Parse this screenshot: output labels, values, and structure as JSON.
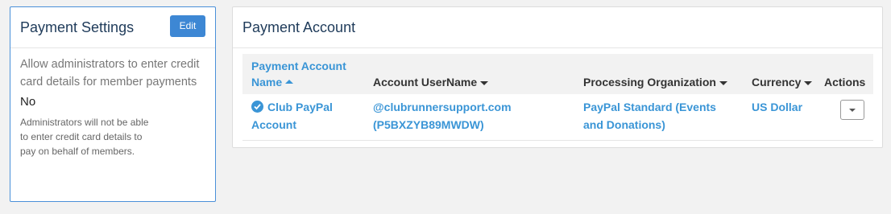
{
  "payment_settings": {
    "title": "Payment Settings",
    "edit_label": "Edit",
    "description": "Allow administrators to enter credit card details for member payments",
    "value": "No",
    "note": "Administrators will not be able to enter credit card details to pay on behalf of members."
  },
  "payment_account": {
    "title": "Payment Account",
    "columns": {
      "name": "Payment Account Name",
      "username": "Account UserName",
      "processing_org": "Processing Organization",
      "currency": "Currency",
      "actions": "Actions"
    },
    "rows": [
      {
        "name": "Club PayPal Account",
        "username": "@clubrunnersupport.com (P5BXZYB89MWDW)",
        "processing_org": "PayPal Standard (Events and Donations)",
        "currency": "US Dollar"
      }
    ]
  },
  "colors": {
    "accent": "#3a95d6",
    "button": "#3d87d4",
    "panel_border_active": "#4a90d9"
  }
}
